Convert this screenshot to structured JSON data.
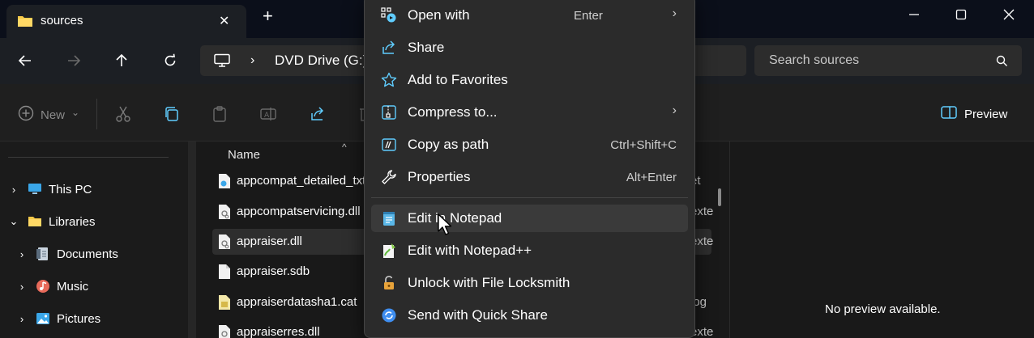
{
  "window": {
    "tab_title": "sources",
    "tab_close": "✕",
    "new_tab": "+",
    "controls": [
      "minimize-icon",
      "maximize-icon",
      "close-icon"
    ]
  },
  "navigation": {
    "address_chevron": "›",
    "address_path": "DVD Drive (G:)",
    "search_placeholder": "Search sources"
  },
  "commandbar": {
    "new_label": "New",
    "new_chevron": "⌄",
    "preview_label": "Preview"
  },
  "navpane": {
    "items": [
      {
        "label": "This PC",
        "chevron": "›",
        "icon": "pc-icon"
      },
      {
        "label": "Libraries",
        "chevron": "⌄",
        "icon": "folder-icon"
      },
      {
        "label": "Documents",
        "chevron": "›",
        "icon": "documents-icon"
      },
      {
        "label": "Music",
        "chevron": "›",
        "icon": "music-icon"
      },
      {
        "label": "Pictures",
        "chevron": "›",
        "icon": "pictures-icon"
      }
    ]
  },
  "filelist": {
    "column_name": "Name",
    "sort_arrow": "^",
    "rows": [
      {
        "name": "appcompat_detailed_txt",
        "type": "et"
      },
      {
        "name": "appcompatservicing.dll",
        "type": "exte"
      },
      {
        "name": "appraiser.dll",
        "type": "exte"
      },
      {
        "name": "appraiser.sdb",
        "type": ""
      },
      {
        "name": "appraiserdatasha1.cat",
        "type": "log"
      },
      {
        "name": "appraiserres.dll",
        "type": "exte"
      }
    ]
  },
  "preview": {
    "empty_text": "No preview available."
  },
  "context_menu": {
    "items": [
      {
        "label": "Open with",
        "accel": "Enter",
        "submenu": "›",
        "icon": "open-with-icon"
      },
      {
        "label": "Share",
        "accel": "",
        "submenu": "",
        "icon": "share-icon"
      },
      {
        "label": "Add to Favorites",
        "accel": "",
        "submenu": "",
        "icon": "star-icon"
      },
      {
        "label": "Compress to...",
        "accel": "",
        "submenu": "›",
        "icon": "zip-icon"
      },
      {
        "label": "Copy as path",
        "accel": "Ctrl+Shift+C",
        "submenu": "",
        "icon": "copy-path-icon"
      },
      {
        "label": "Properties",
        "accel": "Alt+Enter",
        "submenu": "",
        "icon": "wrench-icon"
      },
      {
        "label": "Edit in Notepad",
        "accel": "",
        "submenu": "",
        "icon": "notepad-icon"
      },
      {
        "label": "Edit with Notepad++",
        "accel": "",
        "submenu": "",
        "icon": "notepadpp-icon"
      },
      {
        "label": "Unlock with File Locksmith",
        "accel": "",
        "submenu": "",
        "icon": "lock-icon"
      },
      {
        "label": "Send with Quick Share",
        "accel": "",
        "submenu": "",
        "icon": "quick-share-icon"
      }
    ]
  },
  "colors": {
    "accent": "#60cdff",
    "folder": "#f7c948",
    "menu_bg": "#2b2b2b",
    "hover_bg": "#3a3a3a"
  }
}
